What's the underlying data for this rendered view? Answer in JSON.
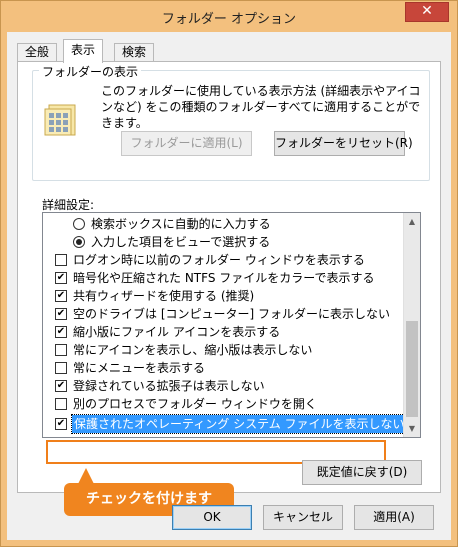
{
  "window": {
    "title": "フォルダー オプション",
    "close_glyph": "✕"
  },
  "tabs": [
    {
      "label": "全般"
    },
    {
      "label": "表示"
    },
    {
      "label": "検索"
    }
  ],
  "folder_view": {
    "group_label": "フォルダーの表示",
    "description": "このフォルダーに使用している表示方法 (詳細表示やアイコンなど) をこの種類のフォルダーすべてに適用することができます。",
    "apply_button": "フォルダーに適用(L)",
    "reset_button": "フォルダーをリセット(R)"
  },
  "advanced": {
    "label": "詳細設定:",
    "items": [
      {
        "type": "radio",
        "checked": false,
        "label": "検索ボックスに自動的に入力する"
      },
      {
        "type": "radio",
        "checked": true,
        "label": "入力した項目をビューで選択する"
      },
      {
        "type": "checkbox",
        "checked": false,
        "label": "ログオン時に以前のフォルダー ウィンドウを表示する"
      },
      {
        "type": "checkbox",
        "checked": true,
        "label": "暗号化や圧縮された NTFS ファイルをカラーで表示する"
      },
      {
        "type": "checkbox",
        "checked": true,
        "label": "共有ウィザードを使用する (推奨)"
      },
      {
        "type": "checkbox",
        "checked": true,
        "label": "空のドライブは [コンピューター] フォルダーに表示しない"
      },
      {
        "type": "checkbox",
        "checked": true,
        "label": "縮小版にファイル アイコンを表示する"
      },
      {
        "type": "checkbox",
        "checked": false,
        "label": "常にアイコンを表示し、縮小版は表示しない"
      },
      {
        "type": "checkbox",
        "checked": false,
        "label": "常にメニューを表示する"
      },
      {
        "type": "checkbox",
        "checked": true,
        "label": "登録されている拡張子は表示しない"
      },
      {
        "type": "checkbox",
        "checked": false,
        "label": "別のプロセスでフォルダー ウィンドウを開く"
      },
      {
        "type": "checkbox",
        "checked": true,
        "label": "保護されたオペレーティング システム ファイルを表示しない (推奨)"
      }
    ],
    "restore_button": "既定値に戻す(D)"
  },
  "annotation": {
    "callout_text": "チェックを付けます",
    "accent": "#f0851f"
  },
  "footer": {
    "ok": "OK",
    "cancel": "キャンセル",
    "apply": "適用(A)"
  },
  "check_mark": "✔"
}
